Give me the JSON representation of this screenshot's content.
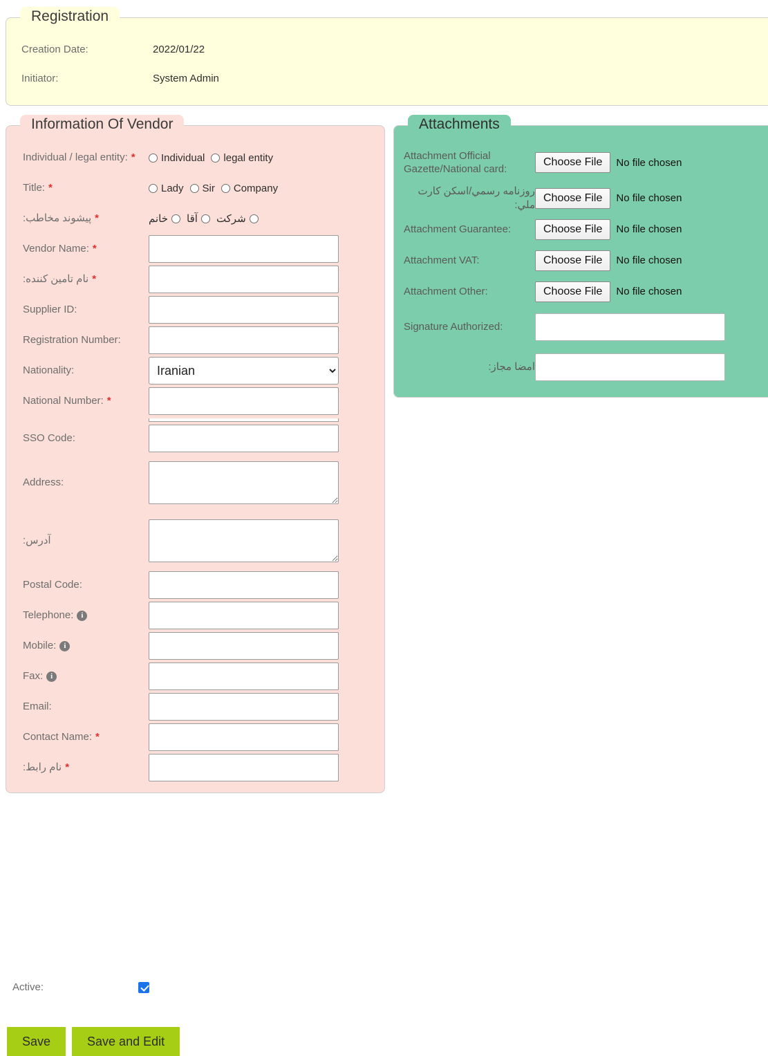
{
  "registration": {
    "legend": "Registration",
    "rows": [
      {
        "label": "Creation Date:",
        "value": "2022/01/22"
      },
      {
        "label": "Initiator:",
        "value": "System Admin"
      }
    ]
  },
  "vendor": {
    "legend": "Information Of Vendor",
    "entity_type": {
      "label": "Individual / legal entity:",
      "required": "*",
      "options": [
        "Individual",
        "legal entity"
      ]
    },
    "title": {
      "label": "Title:",
      "required": "*",
      "options": [
        "Lady",
        "Sir",
        "Company"
      ]
    },
    "title_fa": {
      "label": "پیشوند مخاطب:",
      "required": "*",
      "options": [
        "شرکت",
        "آقا",
        "خانم"
      ]
    },
    "fields": [
      {
        "label": "Vendor Name:",
        "required": "*",
        "value": "",
        "type": "text"
      },
      {
        "label": "نام تامین کننده:",
        "required": "*",
        "value": "",
        "type": "text",
        "rtl": true
      },
      {
        "label": "Supplier ID:",
        "required": "",
        "value": "",
        "type": "text"
      },
      {
        "label": "Registration Number:",
        "required": "",
        "value": "",
        "type": "text"
      },
      {
        "label": "Nationality:",
        "required": "",
        "value": "Iranian",
        "type": "select"
      },
      {
        "label": "National Number:",
        "required": "*",
        "value": "",
        "type": "text"
      },
      {
        "label": "SSO Code:",
        "required": "",
        "value": "",
        "type": "text"
      },
      {
        "label": "Address:",
        "required": "",
        "value": "",
        "type": "textarea"
      },
      {
        "label": "آدرس:",
        "required": "",
        "value": "",
        "type": "textarea",
        "rtl": true
      },
      {
        "label": "Postal Code:",
        "required": "",
        "value": "",
        "type": "text"
      },
      {
        "label": "Telephone:",
        "required": "",
        "value": "",
        "type": "text",
        "info": "i"
      },
      {
        "label": "Mobile:",
        "required": "",
        "value": "",
        "type": "text",
        "info": "i"
      },
      {
        "label": "Fax:",
        "required": "",
        "value": "",
        "type": "text",
        "info": "i"
      },
      {
        "label": "Email:",
        "required": "",
        "value": "",
        "type": "text"
      },
      {
        "label": "Contact Name:",
        "required": "*",
        "value": "",
        "type": "text"
      },
      {
        "label": "نام رابط:",
        "required": "*",
        "value": "",
        "type": "text",
        "rtl": true
      }
    ],
    "nationality_options": [
      "Iranian"
    ]
  },
  "attachments": {
    "legend": "Attachments",
    "choose_file_label": "Choose File",
    "no_file_label": "No file chosen",
    "file_rows": [
      {
        "label": "Attachment Official Gazette/National card:",
        "rtl": false
      },
      {
        "label": "روزنامه رسمي/اسكن كارت ملي:",
        "rtl": true
      },
      {
        "label": "Attachment Guarantee:",
        "rtl": false
      },
      {
        "label": "Attachment VAT:",
        "rtl": false
      },
      {
        "label": "Attachment Other:",
        "rtl": false
      }
    ],
    "signature_rows": [
      {
        "label": "Signature Authorized:",
        "value": "",
        "rtl": false
      },
      {
        "label": "امضا مجاز:",
        "value": "",
        "rtl": true
      }
    ]
  },
  "footer": {
    "active_label": "Active:",
    "active_checked": true,
    "save_label": "Save",
    "save_edit_label": "Save and Edit"
  },
  "colors": {
    "registration_bg": "#ffffdd",
    "vendor_bg": "#fcdfd8",
    "attachments_bg": "#7ccdab",
    "required_star": "#e03030",
    "button_bg": "#a6ce14",
    "checkbox_bg": "#1a73e8"
  }
}
